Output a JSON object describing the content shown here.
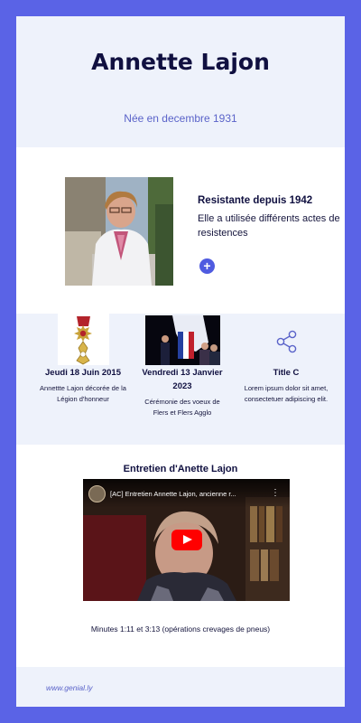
{
  "header": {
    "title": "Annette Lajon",
    "subtitle": "Née en decembre 1931"
  },
  "profile": {
    "heading": "Resistante depuis 1942",
    "text": "Elle a utilisée différents actes de resistences",
    "expand_label": "+"
  },
  "timeline": [
    {
      "title": "Jeudi 18 Juin 2015",
      "text": "Annettte Lajon décorée de  la Légion d'honneur",
      "icon": "legion-honneur-medal-image"
    },
    {
      "title": "Vendredi 13 Janvier 2023",
      "text": "Cérémonie des voeux de Flers et Flers Agglo",
      "icon": "ceremony-photo"
    },
    {
      "title": "Title C",
      "text": "Lorem ipsum dolor sit amet, consectetuer adipiscing elit.",
      "icon": "share-icon"
    }
  ],
  "video": {
    "section_title": "Entretien d'Anette Lajon",
    "title": "[AC] Entretien Annette Lajon, ancienne r...",
    "menu_label": "⋮",
    "caption": "Minutes 1:11 et  3:13 (opérations crevages de pneus)"
  },
  "footer": {
    "link": "www.genial.ly"
  },
  "colors": {
    "frame": "#5a63e6",
    "accent": "#4f5be0",
    "section_bg": "#eef2fb",
    "youtube_red": "#ff0000"
  }
}
